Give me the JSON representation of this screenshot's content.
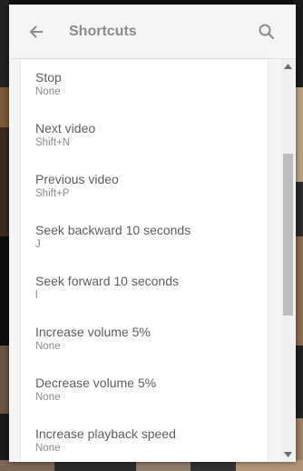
{
  "header": {
    "title": "Shortcuts",
    "back_icon": "arrow-left-icon",
    "search_icon": "search-icon"
  },
  "shortcuts": [
    {
      "label": "Stop",
      "key": "None"
    },
    {
      "label": "Next video",
      "key": "Shift+N"
    },
    {
      "label": "Previous video",
      "key": "Shift+P"
    },
    {
      "label": "Seek backward 10 seconds",
      "key": "J"
    },
    {
      "label": "Seek forward 10 seconds",
      "key": "l"
    },
    {
      "label": "Increase volume 5%",
      "key": "None"
    },
    {
      "label": "Decrease volume 5%",
      "key": "None"
    },
    {
      "label": "Increase playback speed",
      "key": "None"
    }
  ],
  "colors": {
    "panel_bg": "#f5f5f5",
    "title_text": "#8c8c8c",
    "item_text": "#5f5f5f",
    "key_text": "#8a8a8a"
  }
}
